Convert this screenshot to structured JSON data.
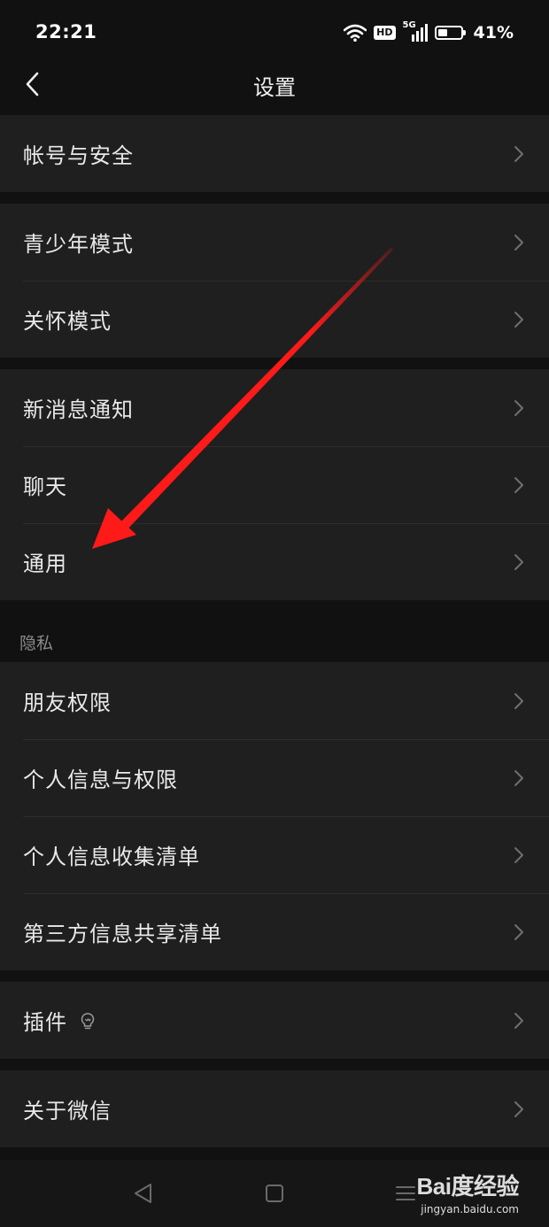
{
  "status_bar": {
    "time": "22:21",
    "hd_badge": "HD",
    "network": "5G",
    "battery_percent": "41%",
    "battery_level": 0.41
  },
  "nav": {
    "title": "设置"
  },
  "groups": [
    {
      "items": [
        {
          "label": "帐号与安全"
        }
      ]
    },
    {
      "items": [
        {
          "label": "青少年模式"
        },
        {
          "label": "关怀模式"
        }
      ]
    },
    {
      "items": [
        {
          "label": "新消息通知"
        },
        {
          "label": "聊天"
        },
        {
          "label": "通用"
        }
      ]
    },
    {
      "section_label": "隐私",
      "items": [
        {
          "label": "朋友权限"
        },
        {
          "label": "个人信息与权限"
        },
        {
          "label": "个人信息收集清单"
        },
        {
          "label": "第三方信息共享清单"
        }
      ]
    },
    {
      "items": [
        {
          "label": "插件"
        }
      ]
    },
    {
      "items": [
        {
          "label": "关于微信"
        }
      ]
    }
  ],
  "watermark": {
    "brand": "Bai度经验",
    "url": "jingyan.baidu.com"
  },
  "colors": {
    "background": "#111111",
    "row_background": "#1f1f1f",
    "annotation_arrow": "#ff1a1a"
  }
}
